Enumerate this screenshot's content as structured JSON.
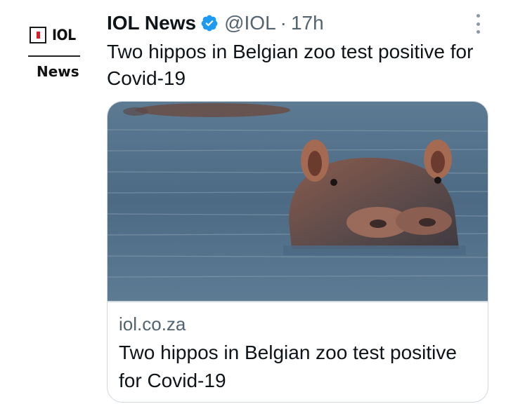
{
  "account": {
    "display_name": "IOL News",
    "handle": "@IOL",
    "separator": "·",
    "time": "17h",
    "avatar_logo_text": "IOL",
    "avatar_logo_subtext": "News",
    "verified_icon": "verified-badge-icon",
    "verified_color": "#1d9bf0"
  },
  "tweet": {
    "text": "Two hippos in Belgian zoo test positive for Covid-19"
  },
  "card": {
    "image": "hippo-in-water-photo",
    "domain": "iol.co.za",
    "title": "Two hippos in Belgian zoo test positive for Covid-19"
  },
  "colors": {
    "text_primary": "#0f1419",
    "text_secondary": "#536471",
    "border": "#cfd9de",
    "logo_red": "#d8202a"
  }
}
